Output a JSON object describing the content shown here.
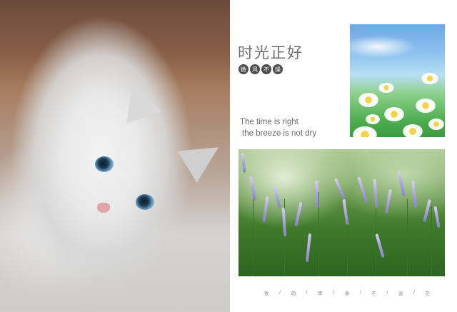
{
  "title": "时光正好",
  "seal_chars": [
    "微",
    "风",
    "不",
    "燥"
  ],
  "quote": {
    "line1": "The time is right",
    "line2": "the breeze is not dry"
  },
  "footer_chars": [
    "致",
    "/",
    "的",
    "/",
    "青",
    "/",
    "春",
    "/",
    "不",
    "/",
    "迷",
    "/",
    "茫"
  ]
}
